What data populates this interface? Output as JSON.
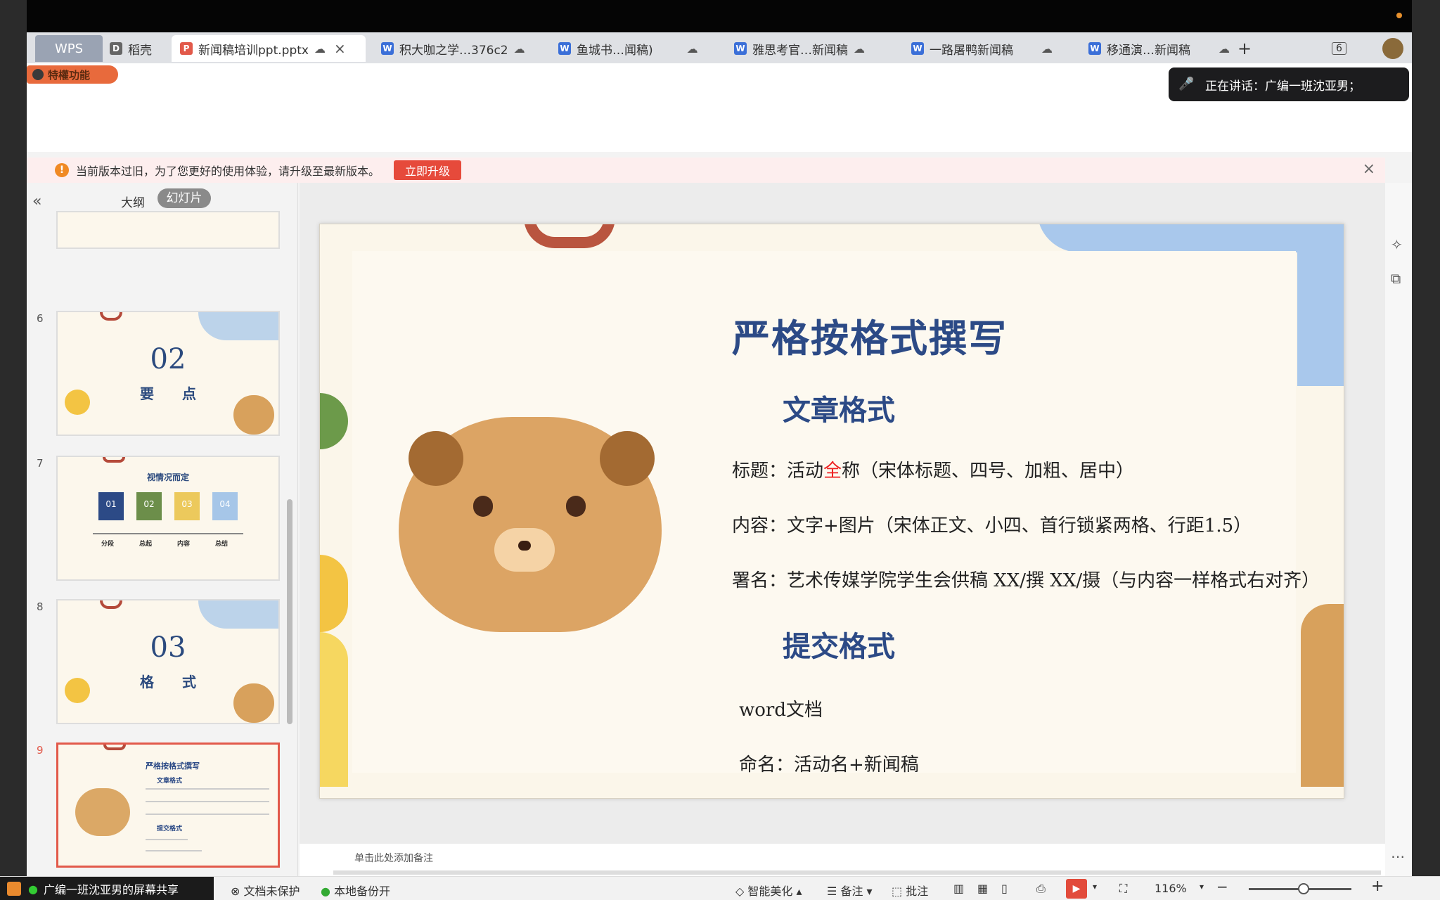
{
  "tabs": {
    "wps": "WPS",
    "items": [
      {
        "label": "稻壳"
      },
      {
        "label": "新闻稿培训ppt.pptx"
      },
      {
        "label": "积大咖之学…376c2"
      },
      {
        "label": "鱼城书…闻稿)"
      },
      {
        "label": "雅思考官…新闻稿"
      },
      {
        "label": "一路屠鸭新闻稿"
      },
      {
        "label": "移通演…新闻稿"
      }
    ],
    "add": "+",
    "window_count": "6"
  },
  "vip_badge": "特權功能",
  "speaking": "正在讲话：广编一班沈亚男；",
  "notice": {
    "text": "当前版本过旧，为了您更好的使用体验，请升级至最新版本。",
    "button": "立即升级"
  },
  "panel": {
    "outline_tab": "大纲",
    "slides_tab": "幻灯片",
    "slides": [
      {
        "num": "6",
        "big": "02",
        "sub": "要　　点"
      },
      {
        "num": "7",
        "title": "视情况而定",
        "steps": [
          "01",
          "02",
          "03",
          "04"
        ],
        "step_labels": [
          "分段",
          "总起",
          "内容",
          "总结"
        ]
      },
      {
        "num": "8",
        "big": "03",
        "sub": "格　　式"
      },
      {
        "num": "9",
        "title": "严格按格式撰写",
        "h1": "文章格式",
        "h2": "提交格式"
      }
    ],
    "add": "+"
  },
  "slide": {
    "title": "严格按格式撰写",
    "section1": "文章格式",
    "line_title_a": "标题：活动",
    "line_title_red": "全",
    "line_title_b": "称（宋体标题、四号、加粗、居中）",
    "line_content": "内容：文字+图片（宋体正文、小四、首行锁紧两格、行距1.5）",
    "line_sign": "署名：艺术传媒学院学生会供稿 XX/撰 XX/摄（与内容一样格式右对齐）",
    "section2": "提交格式",
    "line_word": "word文档",
    "line_name": "命名：活动名+新闻稿"
  },
  "notes_placeholder": "单击此处添加备注",
  "status": {
    "share": "广编一班沈亚男的屏幕共享",
    "doc_protect": "文档未保护",
    "backup": "本地备份开",
    "beautify": "智能美化",
    "notes": "备注",
    "comment": "批注",
    "zoom": "116%"
  },
  "colors": {
    "accent_red": "#e64a3b",
    "title_blue": "#2c4a86"
  }
}
